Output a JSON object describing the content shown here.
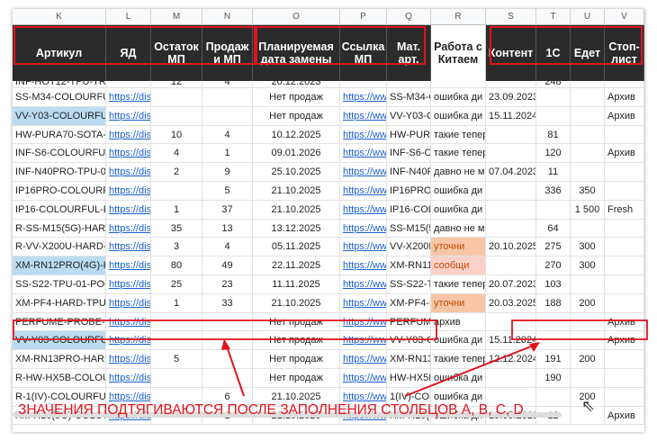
{
  "column_letters": [
    "K",
    "L",
    "M",
    "N",
    "O",
    "P",
    "Q",
    "R",
    "S",
    "T",
    "U",
    "V"
  ],
  "headers": [
    "Артикул",
    "ЯД",
    "Остаток МП",
    "Продаж и МП",
    "Планируемая дата замены",
    "Ссылка МП",
    "Мат. арт.",
    "Работа с Китаем",
    "Контент",
    "1С",
    "Едет",
    "Стоп-лист"
  ],
  "partial_row": [
    "INF-HOT12-TPU-TRA",
    "",
    "12",
    "4",
    "20.12.2023",
    "",
    "",
    "",
    "",
    "248",
    "",
    ""
  ],
  "rows": [
    [
      "SS-M34-COLOURFUI",
      "https://dis",
      "",
      "",
      "Нет продаж",
      "https://ww",
      "SS-M34-C",
      "ошибка ди",
      "23.09.2023",
      "",
      "",
      "Архив"
    ],
    [
      "VV-Y03-COLOURFUL",
      "https://dis",
      "",
      "",
      "Нет продаж",
      "https://ww",
      "VV-Y03-C",
      "ошибка ди",
      "15.11.2024",
      "",
      "",
      "Архив"
    ],
    [
      "HW-PURA70-SOTA-E",
      "https://dis",
      "10",
      "4",
      "10.12.2025",
      "https://ww",
      "HW-PURA",
      "такие тепер",
      "",
      "81",
      "",
      ""
    ],
    [
      "INF-S6-COLOURFUL",
      "https://dis",
      "4",
      "1",
      "09.01.2026",
      "https://ww",
      "INF-S6-C",
      "такие тепер",
      "",
      "120",
      "",
      "Архив"
    ],
    [
      "INF-N40PRO-TPU-01",
      "https://dis",
      "2",
      "9",
      "25.10.2025",
      "https://ww",
      "INF-N40P",
      "давно не м",
      "07.04.2023",
      "11",
      "",
      ""
    ],
    [
      "IP16PRO-COLOURFUL",
      "https://dis",
      "",
      "5",
      "21.10.2025",
      "https://ww",
      "IP16PRO-C",
      "ошибка ди",
      "",
      "336",
      "350",
      ""
    ],
    [
      "IP16-COLOURFUL-BI",
      "https://dis",
      "1",
      "37",
      "21.10.2025",
      "https://ww",
      "IP16-COL",
      "ошибка ди",
      "",
      "",
      "1 500",
      "Fresh"
    ],
    [
      "R-SS-M15(5G)-HARD-",
      "https://dis",
      "35",
      "13",
      "13.12.2025",
      "https://ww",
      "SS-M15(5C",
      "давно не м",
      "",
      "64",
      "",
      ""
    ],
    [
      "R-VV-X200U-HARD-1",
      "https://dis",
      "3",
      "4",
      "05.11.2025",
      "https://ww",
      "VV-X200L",
      "уточни",
      "20.10.2025",
      "275",
      "300",
      ""
    ],
    [
      "XM-RN12PRO(4G)-HA",
      "https://dis",
      "80",
      "49",
      "22.11.2025",
      "https://ww",
      "XM-RN11P",
      "сообщи",
      "",
      "270",
      "300",
      ""
    ],
    [
      "SS-S22-TPU-01-POCK",
      "https://dis",
      "25",
      "23",
      "11.11.2025",
      "https://ww",
      "SS-S22-TP",
      "такие тепер",
      "20.07.2023",
      "103",
      "",
      ""
    ],
    [
      "XM-PF4-HARD-TPU-",
      "https://dis",
      "1",
      "33",
      "21.10.2025",
      "https://ww",
      "XM-PF4-H",
      "уточни",
      "20.03.2025",
      "188",
      "200",
      ""
    ],
    [
      "PERFUME-PROBE-0",
      "https://dis",
      "",
      "",
      "Нет продаж",
      "https://ww",
      "PERFUME",
      "архив",
      "",
      "",
      "",
      "Архив"
    ],
    [
      "VV-Y03-COLOURFUL",
      "https://dis",
      "",
      "",
      "Нет продаж",
      "https://ww",
      "VV-Y03-C",
      "ошибка ди",
      "15.11.2024",
      "",
      "",
      "Архив"
    ],
    [
      "XM-RN13PRO-HARD",
      "https://dis",
      "5",
      "",
      "Нет продаж",
      "https://ww",
      "XM-RN13F",
      "такие тепер",
      "12.12.2024",
      "191",
      "200",
      ""
    ],
    [
      "R-HW-HX5B-COLOU",
      "https://dis",
      "",
      "",
      "Нет продаж",
      "https://ww",
      "HW-HX5B",
      "ошибка ди",
      "",
      "190",
      "",
      ""
    ],
    [
      "R-1(IV)-COLOURFUL-",
      "https://dis",
      "",
      "6",
      "21.10.2025",
      "https://ww",
      "1(IV)-COL",
      "ошибка ди",
      "",
      "",
      "200",
      ""
    ],
    [
      "XM-R10(5G)-COLOUF",
      "https://dis",
      "",
      "1",
      "21.10.2025",
      "https://ww",
      "XM-R10(5",
      "ошибка ди",
      "19.05.2023",
      "12",
      "",
      "Архив"
    ]
  ],
  "highlights": {
    "blue_rows": [
      1,
      13
    ],
    "blue_partial_row": 9,
    "orange_cells": [
      8,
      11
    ],
    "pink_cells": [
      9
    ]
  },
  "annotation": "ЗНАЧЕНИЯ ПОДТЯГИВАЮТСЯ ПОСЛЕ ЗАПОЛНЕНИЯ СТОЛБЦОВ A, B, C, D",
  "colors": {
    "accent_red": "#e0141e",
    "header_dark": "#2b2b2b",
    "link_blue": "#1a5fd0",
    "highlight_blue": "#b9dcf3",
    "highlight_orange": "#f7c6a7"
  }
}
